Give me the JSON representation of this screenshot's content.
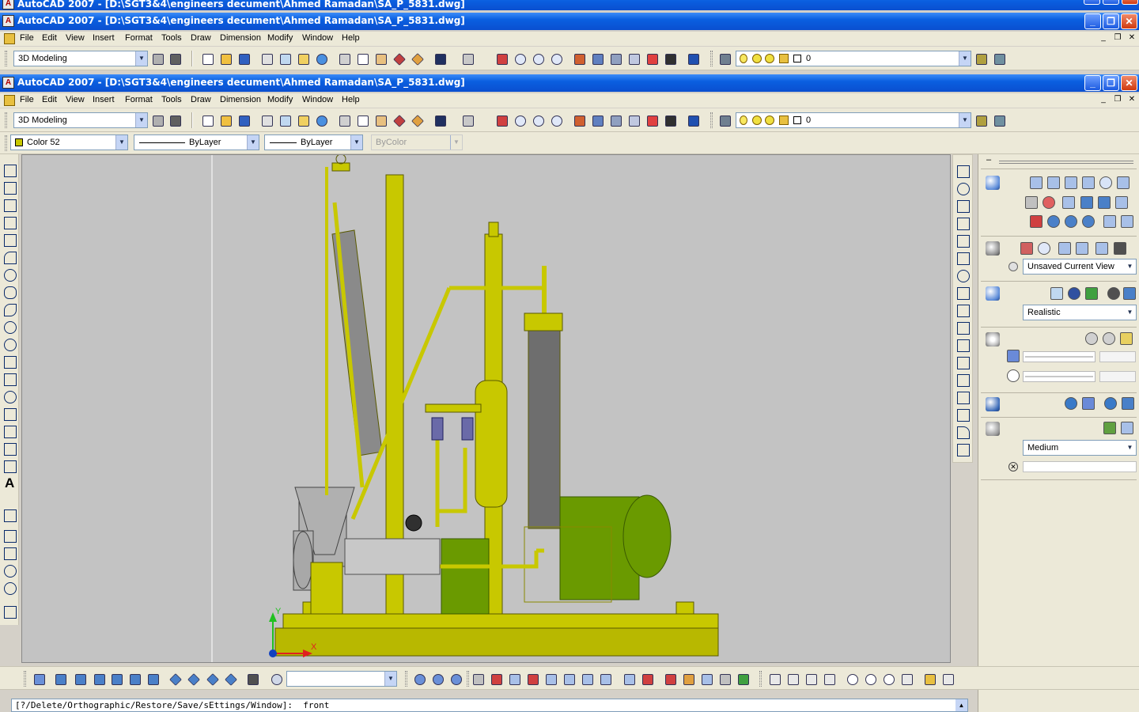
{
  "app": {
    "outer_title": "AutoCAD 2007 - [D:\\SGT3&4\\engineers decument\\Ahmed Ramadan\\SA_P_5831.dwg]",
    "inner_title": "AutoCAD 2007 - [D:\\SGT3&4\\engineers decument\\Ahmed Ramadan\\SA_P_5831.dwg]",
    "app_icon": "autocad-icon",
    "window_buttons": [
      "_",
      "❐",
      "✕"
    ]
  },
  "menu": [
    "File",
    "Edit",
    "View",
    "Insert",
    "Format",
    "Tools",
    "Draw",
    "Dimension",
    "Modify",
    "Window",
    "Help"
  ],
  "workspace": {
    "value": "3D Modeling"
  },
  "layer": {
    "value": "0"
  },
  "properties": {
    "color": "Color 52",
    "color_swatch": "#c8c800",
    "linetype": "ByLayer",
    "lineweight": "ByLayer",
    "plotstyle": "ByColor"
  },
  "dashboard": {
    "view_combo": "Unsaved Current View",
    "visual_style": "Realistic",
    "render_preset": "Medium"
  },
  "bottom_toolbar": {
    "ucs_combo": ""
  },
  "command_line": {
    "text": "[?/Delete/Orthographic/Restore/Save/sEttings/Window]:  front"
  },
  "colors": {
    "title_blue": "#0a4fd0",
    "model_yellow": "#c8c800",
    "motor_green": "#6a9a00",
    "viewport_bg": "#c3c3c3",
    "chrome": "#ece9d8"
  }
}
